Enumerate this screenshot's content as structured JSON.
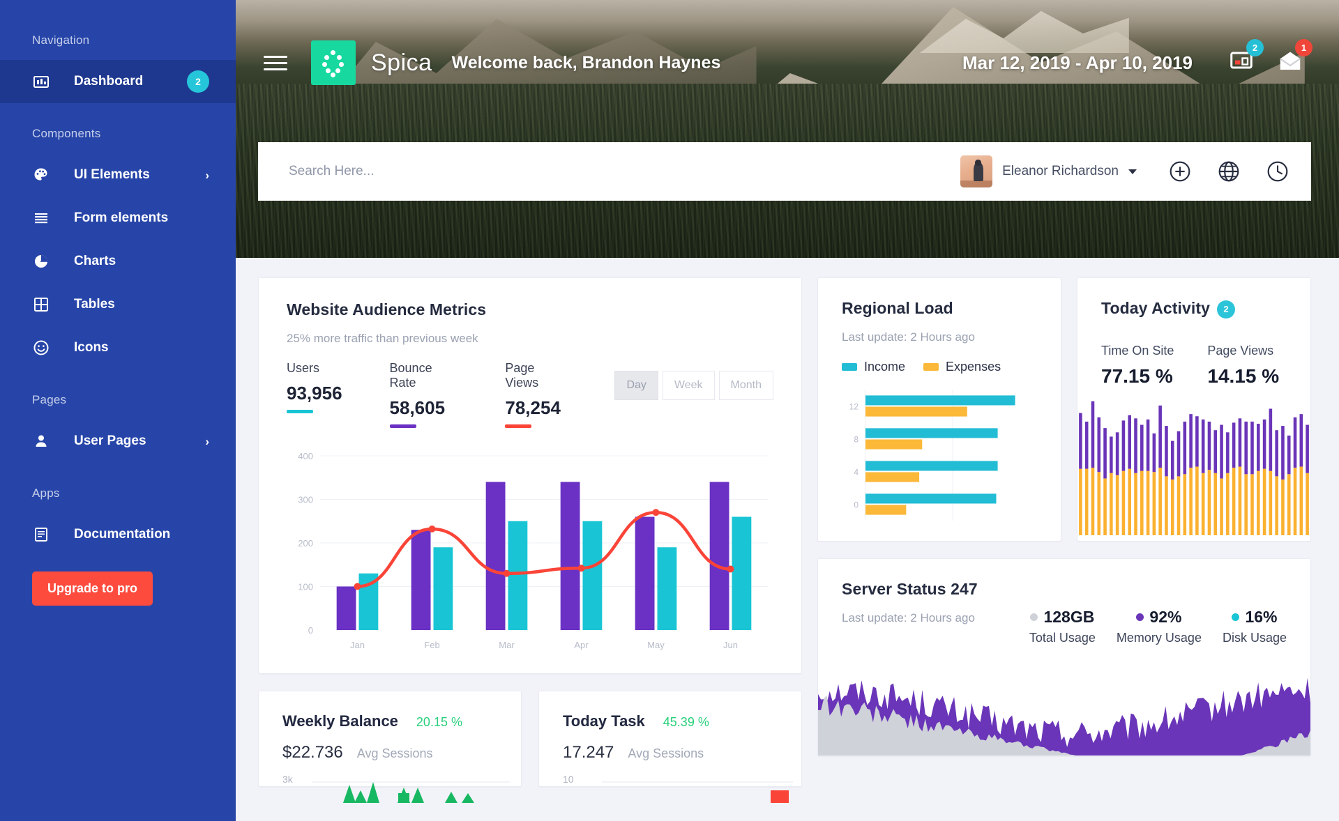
{
  "sidebar": {
    "sections": [
      {
        "caption": "Navigation",
        "items": [
          {
            "label": "Dashboard",
            "icon": "dashboard-icon",
            "badge": "2",
            "active": true
          }
        ]
      },
      {
        "caption": "Components",
        "items": [
          {
            "label": "UI Elements",
            "icon": "palette-icon",
            "chevron": "›"
          },
          {
            "label": "Form elements",
            "icon": "list-icon"
          },
          {
            "label": "Charts",
            "icon": "pie-chart-icon"
          },
          {
            "label": "Tables",
            "icon": "table-icon"
          },
          {
            "label": "Icons",
            "icon": "smiley-icon"
          }
        ]
      },
      {
        "caption": "Pages",
        "items": [
          {
            "label": "User Pages",
            "icon": "user-icon",
            "chevron": "›"
          }
        ]
      },
      {
        "caption": "Apps",
        "items": [
          {
            "label": "Documentation",
            "icon": "document-icon"
          }
        ]
      }
    ],
    "upgrade_label": "Upgrade to pro",
    "accent_bg": "#2745a8",
    "accent_active": "#1e388f",
    "badge_color": "#26c6da",
    "upgrade_color": "#fd4b3e"
  },
  "header": {
    "brand": "Spica",
    "welcome": "Welcome back, Brandon Haynes",
    "date_range": "Mar 12, 2019 - Apr 10, 2019",
    "menu_icon": "hamburger-icon",
    "logo_icon": "spica-logo-icon",
    "notifications": [
      {
        "icon": "monitor-icon",
        "count": "2",
        "color": "#26c0d6"
      },
      {
        "icon": "envelope-icon",
        "count": "1",
        "color": "#f0463a"
      }
    ]
  },
  "search": {
    "placeholder": "Search Here...",
    "value": "",
    "user_name": "Eleanor Richardson",
    "icons": [
      "plus-circle-icon",
      "globe-icon",
      "clock-icon"
    ]
  },
  "audience": {
    "title": "Website Audience Metrics",
    "subtitle": "25% more traffic than previous week",
    "metrics": [
      {
        "label": "Users",
        "value": "93,956",
        "color": "#19c5d4"
      },
      {
        "label": "Bounce Rate",
        "value": "58,605",
        "color": "#6a31c4"
      },
      {
        "label": "Page Views",
        "value": "78,254",
        "color": "#fa4438"
      }
    ],
    "ranges": [
      {
        "label": "Day",
        "active": true
      },
      {
        "label": "Week",
        "active": false
      },
      {
        "label": "Month",
        "active": false
      }
    ]
  },
  "regional": {
    "title": "Regional Load",
    "subtitle": "Last update: 2 Hours ago",
    "legend": [
      {
        "label": "Income",
        "color": "#22bcd4"
      },
      {
        "label": "Expenses",
        "color": "#fbb839"
      }
    ]
  },
  "today_activity": {
    "title": "Today Activity",
    "badge": "2",
    "stats": [
      {
        "label": "Time On Site",
        "value": "77.15 %"
      },
      {
        "label": "Page Views",
        "value": "14.15 %"
      }
    ],
    "colors": {
      "top": "#6a35b8",
      "bottom": "#fbb130"
    }
  },
  "server_status": {
    "title": "Server Status 247",
    "subtitle": "Last update: 2 Hours ago",
    "stats": [
      {
        "value": "128GB",
        "label": "Total Usage",
        "color": "#cfd2d9"
      },
      {
        "value": "92%",
        "label": "Memory Usage",
        "color": "#6a35b8"
      },
      {
        "value": "16%",
        "label": "Disk Usage",
        "color": "#19c5d4"
      }
    ]
  },
  "weekly_balance": {
    "title": "Weekly Balance",
    "percent": "20.15 %",
    "value": "$22.736",
    "sub": "Avg Sessions",
    "axis_label": "3k",
    "color": "#18b863"
  },
  "today_task": {
    "title": "Today Task",
    "percent": "45.39 %",
    "value": "17.247",
    "sub": "Avg Sessions",
    "axis_label": "10",
    "color": "#fa4438"
  },
  "chart_data": [
    {
      "type": "bar",
      "name": "website-audience-metrics",
      "title": "Website Audience Metrics",
      "categories": [
        "Jan",
        "Feb",
        "Mar",
        "Apr",
        "May",
        "Jun"
      ],
      "series": [
        {
          "name": "Bounce Rate",
          "type": "bar",
          "color": "#6a31c4",
          "values": [
            100,
            230,
            340,
            340,
            260,
            340
          ]
        },
        {
          "name": "Users",
          "type": "bar",
          "color": "#19c5d4",
          "values": [
            130,
            190,
            250,
            250,
            190,
            260
          ]
        },
        {
          "name": "Page Views",
          "type": "line",
          "color": "#fa4438",
          "values": [
            100,
            232,
            130,
            142,
            270,
            140
          ]
        }
      ],
      "ylim": [
        0,
        400
      ],
      "yticks": [
        0,
        100,
        200,
        300,
        400
      ],
      "xlabel": "",
      "ylabel": "",
      "grid": true,
      "legend": "none"
    },
    {
      "type": "bar",
      "name": "regional-load",
      "title": "Regional Load",
      "orientation": "horizontal",
      "categories": [
        "12",
        "8",
        "4",
        "0"
      ],
      "yticks": [
        12,
        8,
        4,
        0
      ],
      "series": [
        {
          "name": "Income",
          "color": "#22bcd4",
          "values": [
            10.3,
            9.1,
            9.1,
            9.0
          ]
        },
        {
          "name": "Expenses",
          "color": "#fbb839",
          "values": [
            7.0,
            3.9,
            3.7,
            2.8
          ]
        }
      ],
      "xlim": [
        0,
        12
      ],
      "grid": true,
      "legend": "top"
    },
    {
      "type": "bar",
      "name": "today-activity-sparkbars",
      "title": "Today Activity",
      "stacked": true,
      "series": [
        {
          "name": "upper",
          "color": "#6a35b8",
          "values": [
            52,
            44,
            62,
            51,
            47,
            34,
            40,
            47,
            50,
            51,
            43,
            48,
            36,
            58,
            47,
            36,
            42,
            49,
            50,
            47,
            50,
            45,
            40,
            50,
            38,
            42,
            45,
            49,
            49,
            44,
            46,
            58,
            43,
            50,
            36,
            47,
            49,
            45
          ]
        },
        {
          "name": "lower",
          "color": "#fbb130",
          "values": [
            62,
            62,
            63,
            59,
            53,
            58,
            56,
            60,
            62,
            58,
            60,
            60,
            59,
            63,
            55,
            52,
            55,
            57,
            63,
            64,
            58,
            61,
            58,
            53,
            58,
            63,
            64,
            57,
            57,
            60,
            62,
            60,
            55,
            52,
            57,
            63,
            64,
            58
          ]
        }
      ],
      "grid": false,
      "legend": "none"
    },
    {
      "type": "area",
      "name": "server-status-area",
      "title": "Server Status 247",
      "series": [
        {
          "name": "Memory Usage",
          "color": "#6a35b8"
        },
        {
          "name": "Total Usage",
          "color": "#cfd2d9"
        }
      ],
      "grid": false,
      "legend": "none"
    },
    {
      "type": "area",
      "name": "weekly-balance-spark",
      "title": "Weekly Balance",
      "series": [
        {
          "name": "balance",
          "color": "#18b863"
        }
      ],
      "yticks": [
        "3k"
      ],
      "grid": false,
      "legend": "none"
    },
    {
      "type": "bar",
      "name": "today-task-spark",
      "title": "Today Task",
      "series": [
        {
          "name": "task",
          "color": "#fa4438"
        }
      ],
      "yticks": [
        "10"
      ],
      "grid": false,
      "legend": "none"
    }
  ]
}
